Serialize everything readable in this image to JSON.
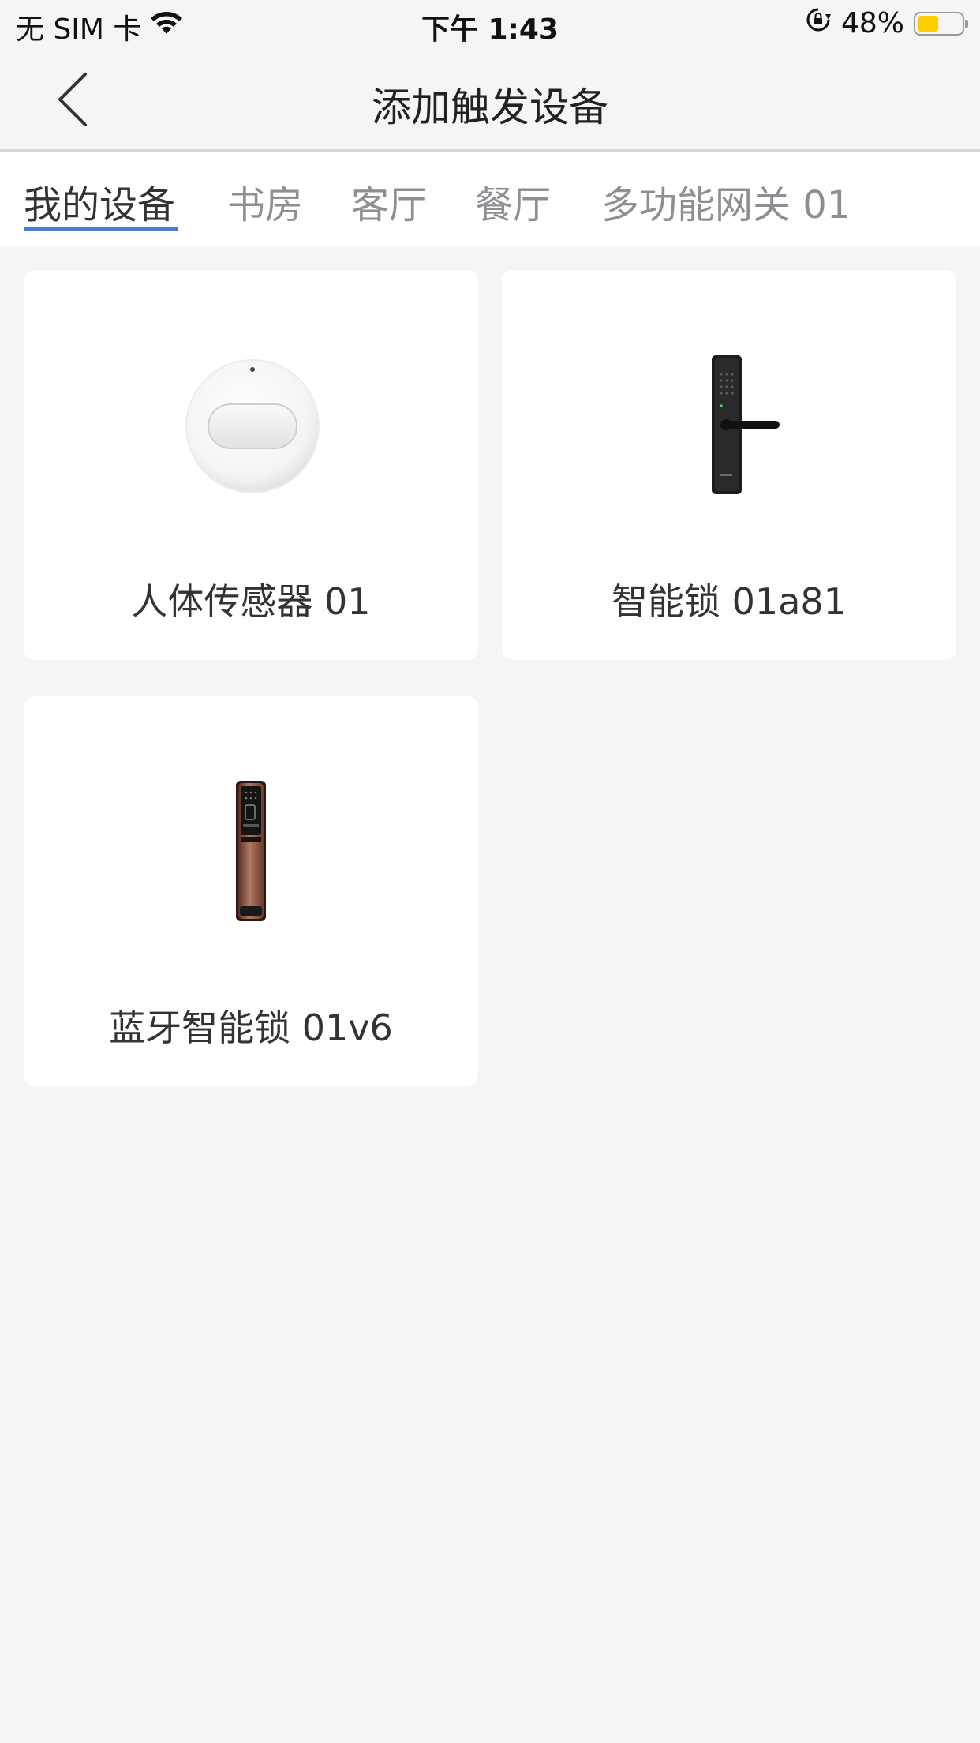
{
  "status_bar": {
    "carrier": "无 SIM 卡",
    "time": "下午 1:43",
    "battery_percent": "48%",
    "battery_level": 0.48,
    "battery_color": "#ffcc00",
    "icons": [
      "wifi-icon",
      "orientation-lock-icon",
      "battery-icon"
    ]
  },
  "nav": {
    "title": "添加触发设备",
    "back_icon": "chevron-left-icon"
  },
  "tabs": [
    {
      "label": "我的设备",
      "active": true
    },
    {
      "label": "书房",
      "active": false
    },
    {
      "label": "客厅",
      "active": false
    },
    {
      "label": "餐厅",
      "active": false
    },
    {
      "label": "多功能网关 01",
      "active": false
    }
  ],
  "accent_color": "#4a7bd6",
  "devices": [
    {
      "name": "人体传感器 01",
      "image": "motion-sensor-image"
    },
    {
      "name": "智能锁 01a81",
      "image": "smart-lock-image"
    },
    {
      "name": "蓝牙智能锁 01v6",
      "image": "bluetooth-lock-image"
    }
  ]
}
